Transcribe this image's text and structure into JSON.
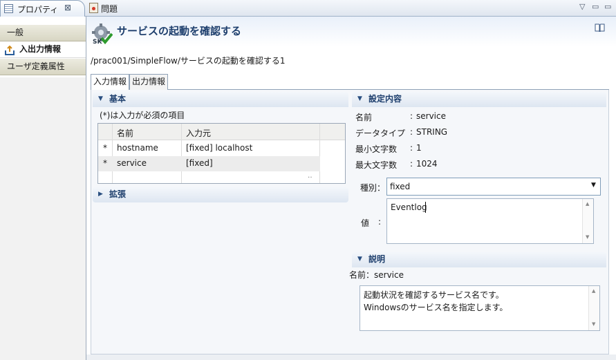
{
  "tabs": {
    "properties_label": "プロパティ",
    "properties_close": "⊠",
    "problems_label": "問題",
    "window_controls": [
      "▽",
      "▭",
      "▭"
    ]
  },
  "sidebar": {
    "items": [
      {
        "label": "一般"
      },
      {
        "label": "入出力情報"
      },
      {
        "label": "ユーザ定義属性"
      }
    ]
  },
  "header": {
    "title": "サービスの起動を確認する",
    "path": "/prac001/SimpleFlow/サービスの起動を確認する1"
  },
  "io_tabs": [
    "入力情報",
    "出力情報"
  ],
  "basic": {
    "title": "基本",
    "required_note": "(*)は入力が必須の項目",
    "columns": [
      "名前",
      "入力元"
    ],
    "rows": [
      {
        "mark": "*",
        "name": "hostname",
        "source": "[fixed] localhost"
      },
      {
        "mark": "*",
        "name": "service",
        "source": "[fixed]"
      }
    ],
    "trailing": "‥"
  },
  "extended": {
    "title": "拡張"
  },
  "settings": {
    "title": "設定内容",
    "fields": [
      {
        "label": "名前",
        "sep": ":",
        "value": "service"
      },
      {
        "label": "データタイプ",
        "sep": ":",
        "value": "STRING"
      },
      {
        "label": "最小文字数",
        "sep": ":",
        "value": "1"
      },
      {
        "label": "最大文字数",
        "sep": ":",
        "value": "1024"
      }
    ],
    "kind_label": "種別：",
    "kind_value": "fixed",
    "value_label": "値",
    "value_sep": ":",
    "value_text": "Eventlog"
  },
  "description": {
    "title": "説明",
    "name_line": "名前：service",
    "text_line1": "起動状況を確認するサービス名です。",
    "text_line2": "Windowsのサービス名を指定します。"
  },
  "icons": {
    "tab_properties": "properties-icon",
    "tab_problems": "problems-icon",
    "header_gear": "gear-check-icon",
    "header_help": "book-help-icon",
    "nav_io": "export-icon"
  },
  "colors": {
    "title": "#1e3f6d",
    "accent": "#2a4f80"
  }
}
